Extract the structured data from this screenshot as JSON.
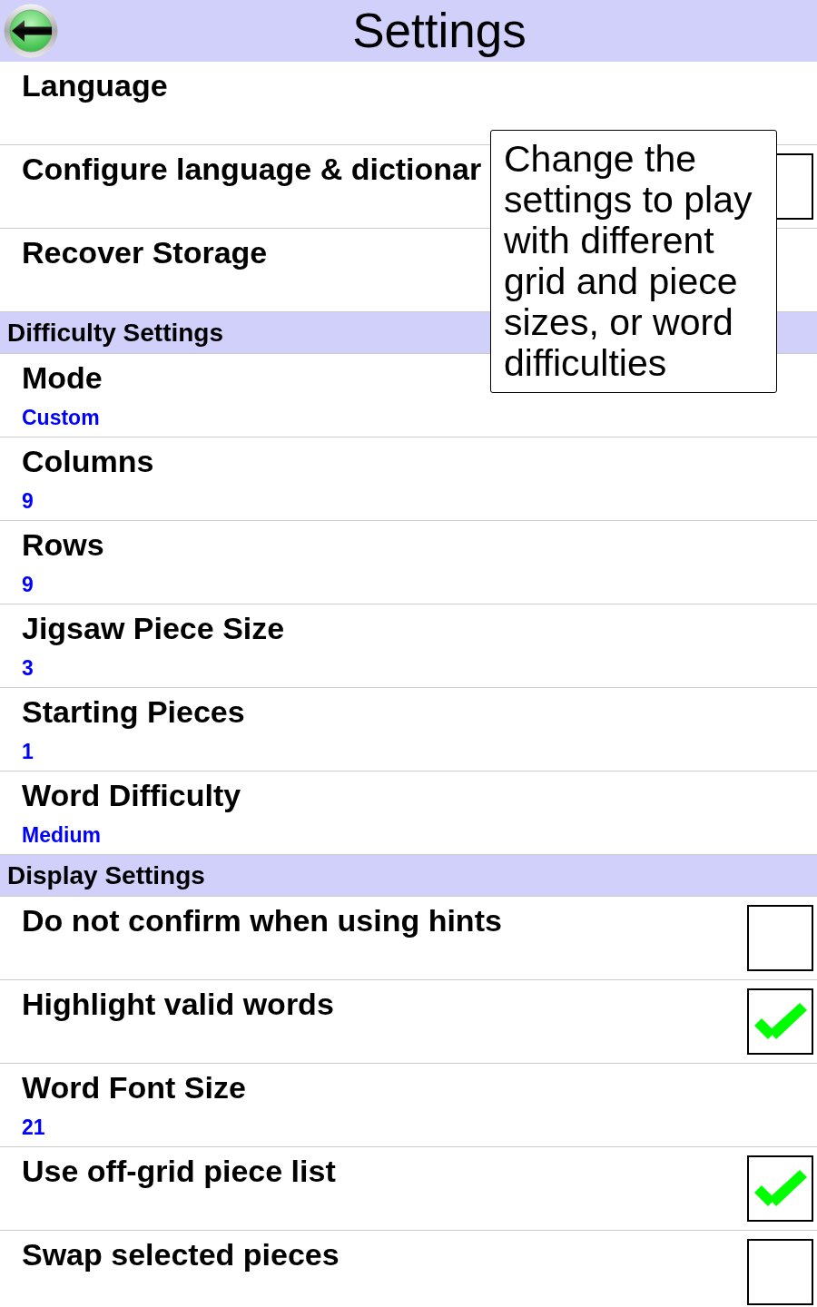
{
  "header": {
    "title": "Settings"
  },
  "sections": [
    {
      "items": [
        {
          "kind": "link",
          "title": "Language"
        },
        {
          "kind": "checkbox",
          "title": "Configure language & dictionar",
          "checked": false
        },
        {
          "kind": "link",
          "title": "Recover Storage"
        }
      ]
    },
    {
      "title": "Difficulty Settings",
      "items": [
        {
          "kind": "value",
          "title": "Mode",
          "value": "Custom"
        },
        {
          "kind": "value",
          "title": "Columns",
          "value": "9"
        },
        {
          "kind": "value",
          "title": "Rows",
          "value": "9"
        },
        {
          "kind": "value",
          "title": "Jigsaw Piece Size",
          "value": "3"
        },
        {
          "kind": "value",
          "title": "Starting Pieces",
          "value": "1"
        },
        {
          "kind": "value",
          "title": "Word Difficulty",
          "value": "Medium"
        }
      ]
    },
    {
      "title": "Display Settings",
      "items": [
        {
          "kind": "checkbox",
          "title": "Do not confirm when using hints",
          "checked": false
        },
        {
          "kind": "checkbox",
          "title": "Highlight valid words",
          "checked": true
        },
        {
          "kind": "value",
          "title": "Word Font Size",
          "value": "21"
        },
        {
          "kind": "checkbox",
          "title": "Use off-grid piece list",
          "checked": true
        },
        {
          "kind": "checkbox",
          "title": "Swap selected pieces",
          "checked": false
        }
      ]
    }
  ],
  "tooltip": {
    "text": "Change the settings to play with different grid and piece sizes, or word difficulties"
  }
}
